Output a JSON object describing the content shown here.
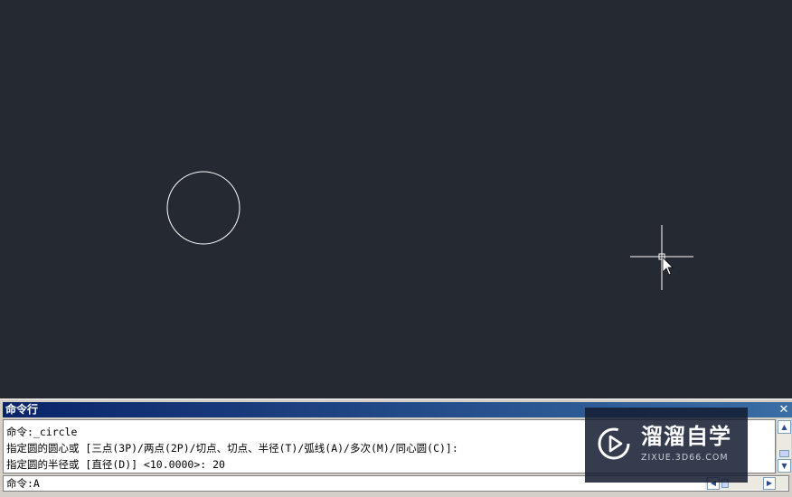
{
  "command_window": {
    "title": "命令行",
    "close_symbol": "✕",
    "history": [
      "命令:_circle",
      "指定圆的圆心或 [三点(3P)/两点(2P)/切点、切点、半径(T)/弧线(A)/多次(M)/同心圆(C)]:",
      "指定圆的半径或 [直径(D)] <10.0000>: 20"
    ],
    "input_text": "命令:A"
  },
  "watermark": {
    "brand": "溜溜自学",
    "url": "ZIXUE.3D66.COM"
  },
  "colors": {
    "canvas_background": "#252a32",
    "drawing_line": "#ffffff",
    "panel_background": "#d4d0c8",
    "titlebar": "#0a246a"
  },
  "icons": {
    "cursor": "crosshair-cursor-icon",
    "scroll_up": "arrow-up-icon",
    "scroll_down": "arrow-down-icon",
    "scroll_left": "arrow-left-icon",
    "scroll_right": "arrow-right-icon",
    "logo": "play-logo-icon"
  }
}
